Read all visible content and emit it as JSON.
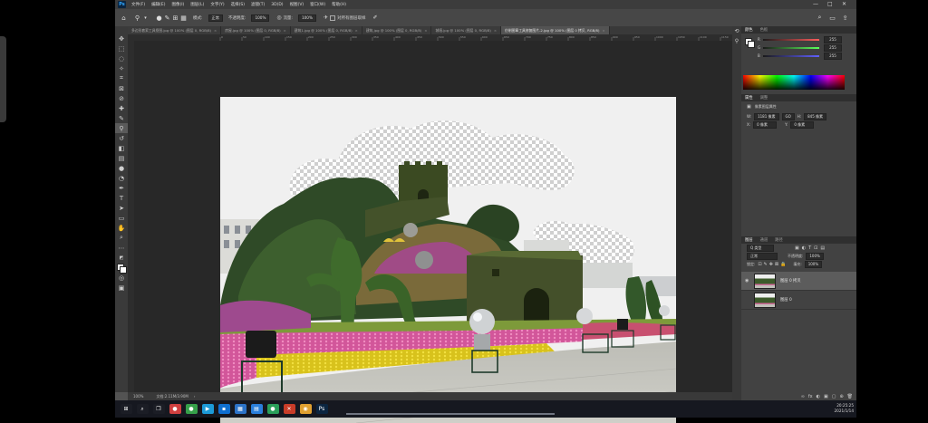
{
  "menubar": {
    "logo": "Ps",
    "items": [
      "文件(F)",
      "编辑(E)",
      "图像(I)",
      "图层(L)",
      "文字(Y)",
      "选择(S)",
      "滤镜(T)",
      "3D(D)",
      "视图(V)",
      "窗口(W)",
      "帮助(H)"
    ],
    "window_controls": [
      "—",
      "□",
      "✕"
    ]
  },
  "options": {
    "mode_label": "模式:",
    "mode_value": "正常",
    "opacity_label": "不透明度:",
    "opacity_value": "100%",
    "flow_label": "流量:",
    "flow_value": "100%",
    "sample_all_layers": "对所有图层取样"
  },
  "tabs": [
    {
      "label": "多边形套索工具抠图.jpg @ 100% (图层 0, RGB/8)",
      "close": "×",
      "active": false
    },
    {
      "label": "房屋.jpg @ 100% (图层 0, RGB/8)",
      "close": "×",
      "active": false
    },
    {
      "label": "建筑1.jpg @ 100% (图层 0, RGB/8)",
      "close": "×",
      "active": false
    },
    {
      "label": "建筑.jpg @ 100% (图层 0, RGB/8)",
      "close": "×",
      "active": false
    },
    {
      "label": "城墙.jpg @ 100% (图层 0, RGB/8)",
      "close": "×",
      "active": false
    },
    {
      "label": "仿制图章工具修复图片-2.jpg @ 100% (图层 0 拷贝, RGB/8)",
      "close": "×",
      "active": true
    }
  ],
  "ruler_ticks": [
    "0",
    "50",
    "100",
    "150",
    "200",
    "250",
    "300",
    "350",
    "400",
    "450",
    "500",
    "550",
    "600",
    "650",
    "700",
    "750",
    "800",
    "850",
    "900",
    "950",
    "1000",
    "1050",
    "1100",
    "1150",
    "1200",
    "1250"
  ],
  "status": {
    "zoom": "100%",
    "doc": "文档:2.11M/3.90M",
    "arrow": "›"
  },
  "color_panel": {
    "tabs": [
      "颜色",
      "色板"
    ],
    "rows": [
      {
        "letter": "R",
        "value": "255",
        "color": "#ff5c5c"
      },
      {
        "letter": "G",
        "value": "255",
        "color": "#5cff5c"
      },
      {
        "letter": "B",
        "value": "255",
        "color": "#6060ff"
      }
    ]
  },
  "properties_panel": {
    "tabs": [
      "属性",
      "调整"
    ],
    "title": "像素图层属性",
    "w_label": "W:",
    "w_value": "1181 像素",
    "link": "GO",
    "h_label": "H:",
    "h_value": "845 像素",
    "x_label": "X:",
    "x_value": "0 像素",
    "y_label": "Y:",
    "y_value": "0 像素"
  },
  "layers_panel": {
    "tabs": [
      "图层",
      "通道",
      "路径"
    ],
    "filter": "Q 类型",
    "blend_mode": "正常",
    "opacity_label": "不透明度:",
    "opacity_value": "100%",
    "lock_label": "锁定:",
    "fill_label": "填充:",
    "fill_value": "100%",
    "layers": [
      {
        "name": "图层 0 拷贝",
        "selected": true,
        "visible": true
      },
      {
        "name": "图层 0",
        "selected": false,
        "visible": false
      }
    ],
    "footer_icons": [
      "∞",
      "fx",
      "◐",
      "▣",
      "▢",
      "⊕",
      "🗑"
    ]
  },
  "taskbar": {
    "icons": [
      {
        "name": "windows-start-icon",
        "glyph": "⊞",
        "color": "#1b1d25"
      },
      {
        "name": "search-icon",
        "glyph": "⌕",
        "color": "#1b1d25"
      },
      {
        "name": "task-view-icon",
        "glyph": "❐",
        "color": "#1b1d25"
      },
      {
        "name": "app-icon-1",
        "glyph": "●",
        "color": "#d04040"
      },
      {
        "name": "app-icon-2",
        "glyph": "●",
        "color": "#36a04a"
      },
      {
        "name": "app-icon-3",
        "glyph": "▶",
        "color": "#1c9ad8"
      },
      {
        "name": "app-icon-4",
        "glyph": "▪",
        "color": "#0f6fd0"
      },
      {
        "name": "app-icon-5",
        "glyph": "▦",
        "color": "#2c73c8"
      },
      {
        "name": "app-icon-6",
        "glyph": "▤",
        "color": "#2a7fdc"
      },
      {
        "name": "app-icon-7",
        "glyph": "●",
        "color": "#2a9f5a"
      },
      {
        "name": "app-icon-8",
        "glyph": "✕",
        "color": "#c83c28"
      },
      {
        "name": "browser-icon",
        "glyph": "◉",
        "color": "#e0a030"
      },
      {
        "name": "photoshop-icon",
        "glyph": "Ps",
        "color": "#0b2540"
      }
    ],
    "time": "20:25:25",
    "date": "2021/1/14"
  }
}
